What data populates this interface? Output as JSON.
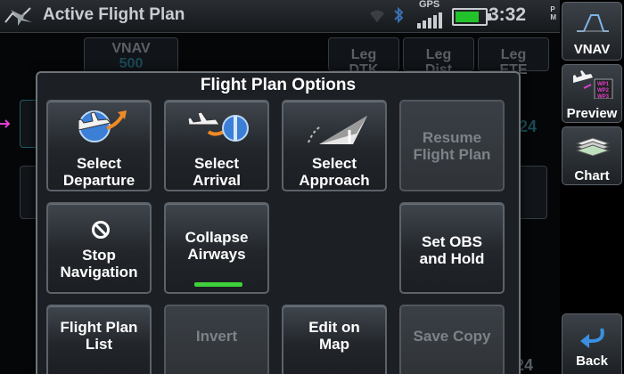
{
  "header": {
    "title": "Active Flight Plan",
    "gps_label": "GPS",
    "time": "3:32",
    "ampm": "P\nM",
    "battery_level": 0.8
  },
  "background": {
    "vnav_label": "VNAV",
    "vnav_value": "500",
    "leg_dtk": "Leg\nDTK",
    "leg_dist": "Leg\nDist",
    "leg_ete": "Leg\nETE",
    "row_value": "24",
    "bottom_value": "24"
  },
  "dialog": {
    "title": "Flight Plan Options",
    "buttons": [
      {
        "label": "Select\nDeparture",
        "enabled": true,
        "icon": "departure-icon"
      },
      {
        "label": "Select\nArrival",
        "enabled": true,
        "icon": "arrival-icon"
      },
      {
        "label": "Select\nApproach",
        "enabled": true,
        "icon": "approach-icon"
      },
      {
        "label": "Resume\nFlight Plan",
        "enabled": false
      },
      {
        "label": "Stop\nNavigation",
        "enabled": true,
        "icon": "prohibit-icon"
      },
      {
        "label": "Collapse\nAirways",
        "enabled": true,
        "toggle_on": true
      },
      {
        "label": "Set OBS\nand Hold",
        "enabled": true
      },
      {
        "label": "Flight Plan\nList",
        "enabled": true
      },
      {
        "label": "Invert",
        "enabled": false
      },
      {
        "label": "Edit on\nMap",
        "enabled": true
      },
      {
        "label": "Save Copy",
        "enabled": false
      }
    ]
  },
  "sidebar": {
    "vnav": "VNAV",
    "preview": "Preview",
    "chart": "Chart",
    "back": "Back"
  },
  "colors": {
    "toggle_on": "#3fd13a",
    "battery": "#22c32a",
    "accent_magenta": "#e23fd0"
  }
}
